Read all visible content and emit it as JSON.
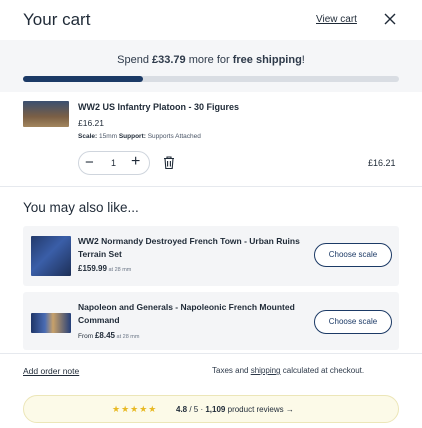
{
  "header": {
    "title": "Your cart",
    "view_cart": "View cart",
    "close_icon": "close-icon"
  },
  "shipping": {
    "prefix": "Spend ",
    "amount": "£33.79",
    "middle": " more for ",
    "bold": "free shipping",
    "suffix": "!",
    "progress_fraction": 0.32
  },
  "cart_item": {
    "name": "WW2 US Infantry Platoon - 30 Figures",
    "price": "£16.21",
    "scale_label": "Scale:",
    "scale_value": " 15mm ",
    "support_label": "Support:",
    "support_value": " Supports Attached",
    "quantity": "1",
    "minus": "−",
    "plus": "+",
    "trash_icon": "trash-icon",
    "total": "£16.21"
  },
  "recommendations": {
    "title": "You may also like...",
    "items": [
      {
        "name": "WW2 Normandy Destroyed French Town - Urban Ruins Terrain Set",
        "from": "",
        "price": "£159.99",
        "scale": " at 28 mm",
        "button": "Choose scale"
      },
      {
        "name": "Napoleon and Generals - Napoleonic French Mounted Command",
        "from": "From ",
        "price": "£8.45",
        "scale": " at 28 mm",
        "button": "Choose scale"
      }
    ]
  },
  "footer": {
    "add_note": "Add order note",
    "taxes_prefix": "Taxes and ",
    "taxes_link": "shipping",
    "taxes_suffix": " calculated at checkout.",
    "stars": "★★★★★",
    "rating": "4.8",
    "rating_suffix": " / 5 · ",
    "review_count": "1,109",
    "review_text": " product reviews →"
  },
  "colors": {
    "navy": "#1c3a66",
    "star": "#e8b923",
    "banner_bg": "#f5f6f8",
    "review_bg": "#fcfae8"
  }
}
